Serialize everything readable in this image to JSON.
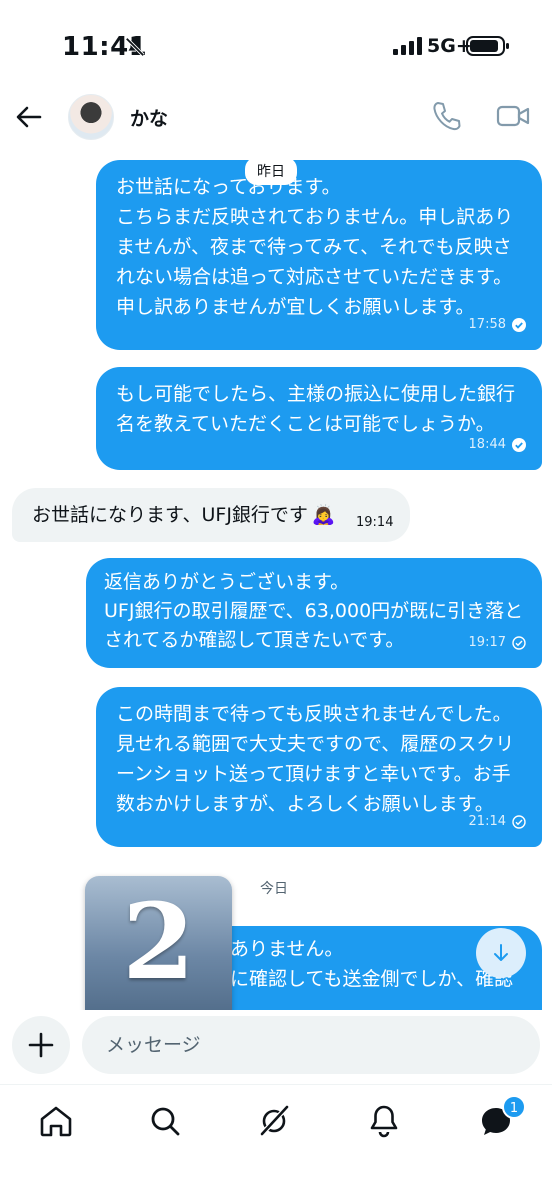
{
  "status": {
    "time": "11:41",
    "network": "5G+"
  },
  "header": {
    "contact_name": "かな"
  },
  "chat": {
    "date_yesterday": "昨日",
    "date_today": "今日",
    "messages": [
      {
        "dir": "out",
        "text": "お世話になっております。\nこちらまだ反映されておりません。申し訳ありませんが、夜まで待ってみて、それでも反映されない場合は追って対応させていただきます。\n申し訳ありませんが宜しくお願いします。",
        "time": "17:58"
      },
      {
        "dir": "out",
        "text": "もし可能でしたら、主様の振込に使用した銀行名を教えていただくことは可能でしょうか。",
        "time": "18:44"
      },
      {
        "dir": "in",
        "text": "お世話になります、UFJ銀行です",
        "emoji": "🙇‍♀️",
        "time": "19:14"
      },
      {
        "dir": "out",
        "text": "返信ありがとうございます。\nUFJ銀行の取引履歴で、63,000円が既に引き落とされてるか確認して頂きたいです。",
        "time": "19:17"
      },
      {
        "dir": "out",
        "text": "この時間まで待っても反映されませんでした。\n見せれる範囲で大丈夫ですので、履歴のスクリーンショット送って頂けますと幸いです。お手数おかけしますが、よろしくお願いします。",
        "time": "21:14"
      },
      {
        "dir": "out",
        "text": "ありません。\nに確認しても送金側でしか、確認"
      }
    ],
    "overlay_badge": "2"
  },
  "composer": {
    "placeholder": "メッセージ"
  },
  "nav": {
    "messages_badge": "1"
  },
  "colors": {
    "accent": "#1d9bf0",
    "incoming": "#eff3f4"
  },
  "icons": [
    "bell-slash-icon",
    "signal-icon",
    "battery-icon",
    "back-arrow-icon",
    "phone-icon",
    "video-icon",
    "plus-icon",
    "home-icon",
    "search-icon",
    "grok-icon",
    "bell-icon",
    "messages-icon",
    "arrow-down-icon",
    "read-check-icon",
    "sent-check-icon"
  ]
}
